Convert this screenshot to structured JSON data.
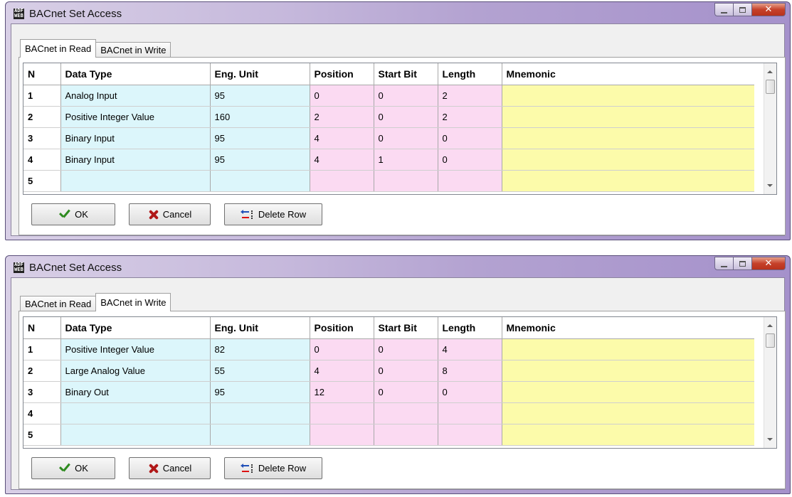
{
  "windows": [
    {
      "title": "BACnet Set Access",
      "tabs": [
        {
          "label": "BACnet in Read",
          "active": true
        },
        {
          "label": "BACnet in Write",
          "active": false
        }
      ],
      "columns": [
        "N",
        "Data Type",
        "Eng. Unit",
        "Position",
        "Start Bit",
        "Length",
        "Mnemonic"
      ],
      "rows": [
        [
          "1",
          "Analog Input",
          "95",
          "0",
          "0",
          "2",
          ""
        ],
        [
          "2",
          "Positive Integer Value",
          "160",
          "2",
          "0",
          "2",
          ""
        ],
        [
          "3",
          "Binary Input",
          "95",
          "4",
          "0",
          "0",
          ""
        ],
        [
          "4",
          "Binary Input",
          "95",
          "4",
          "1",
          "0",
          ""
        ],
        [
          "5",
          "",
          "",
          "",
          "",
          "",
          ""
        ]
      ],
      "buttons": {
        "ok": "OK",
        "cancel": "Cancel",
        "delete_row": "Delete Row"
      }
    },
    {
      "title": "BACnet Set Access",
      "tabs": [
        {
          "label": "BACnet in Read",
          "active": false
        },
        {
          "label": "BACnet in Write",
          "active": true
        }
      ],
      "columns": [
        "N",
        "Data Type",
        "Eng. Unit",
        "Position",
        "Start Bit",
        "Length",
        "Mnemonic"
      ],
      "rows": [
        [
          "1",
          "Positive Integer Value",
          "82",
          "0",
          "0",
          "4",
          ""
        ],
        [
          "2",
          "Large Analog Value",
          "55",
          "4",
          "0",
          "8",
          ""
        ],
        [
          "3",
          "Binary Out",
          "95",
          "12",
          "0",
          "0",
          ""
        ],
        [
          "4",
          "",
          "",
          "",
          "",
          "",
          ""
        ],
        [
          "5",
          "",
          "",
          "",
          "",
          "",
          ""
        ]
      ],
      "buttons": {
        "ok": "OK",
        "cancel": "Cancel",
        "delete_row": "Delete Row"
      }
    }
  ],
  "app_icon_text": "ADF WEB",
  "colors": {
    "data_type_bg": "#dcf6fb",
    "position_bg": "#fbdaf2",
    "mnemonic_bg": "#fcfbaa",
    "close_button": "#c6412a"
  }
}
